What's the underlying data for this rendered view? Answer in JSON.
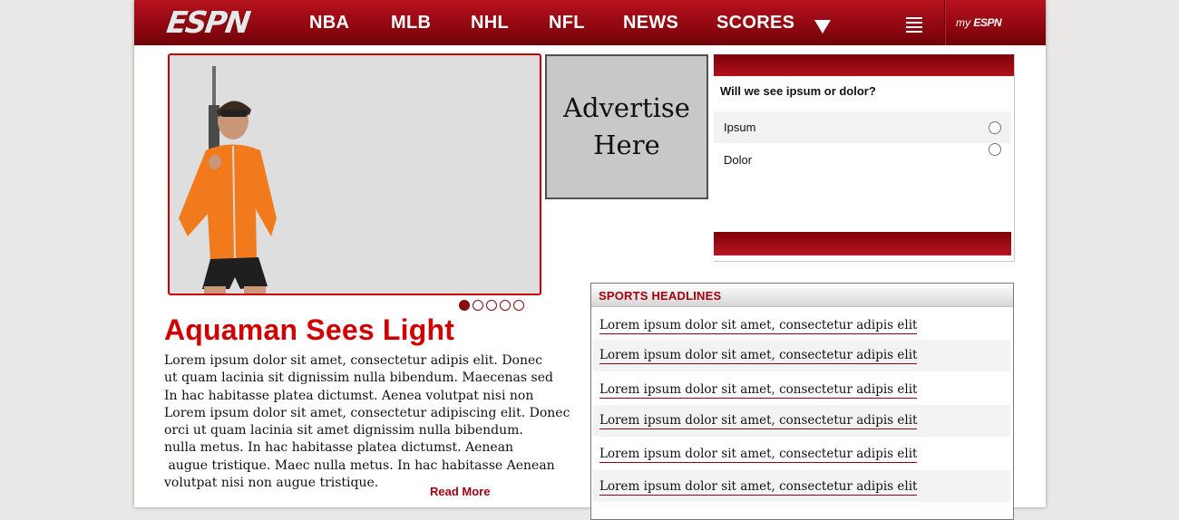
{
  "header": {
    "logo_text": "ESPN",
    "nav": [
      "NBA",
      "MLB",
      "NHL",
      "NFL",
      "NEWS",
      "SCORES"
    ],
    "my_label_prefix": "my",
    "my_label_brand": "ESPN"
  },
  "hero": {
    "slide_count": 5,
    "active_slide": 1,
    "headline": "Aquaman Sees Light",
    "body_lines": [
      "Lorem ipsum dolor sit amet, consectetur adipis elit. Donec",
      "ut quam lacinia sit dignissim nulla bibendum. Maecenas sed",
      "In hac habitasse platea dictumst. Aenea volutpat nisi non",
      "Lorem ipsum dolor sit amet, consectetur adipiscing elit. Donec",
      "orci ut quam lacinia sit amet dignissim nulla bibendum.",
      "nulla metus. In hac habitasse platea dictumst. Aenean",
      " augue tristique. Maec nulla metus. In hac habitasse Aenean",
      "volutpat nisi non augue tristique."
    ],
    "read_more": "Read More"
  },
  "ad": {
    "line1": "Advertise",
    "line2": "Here"
  },
  "poll": {
    "question": "Will we see ipsum or dolor?",
    "options": [
      "Ipsum",
      "Dolor"
    ]
  },
  "headlines": {
    "title": "SPORTS HEADLINES",
    "items": [
      "Lorem ipsum dolor sit amet, consectetur adipis elit",
      "Lorem ipsum dolor sit amet, consectetur adipis elit",
      "Lorem ipsum dolor sit amet, consectetur adipis elit",
      "Lorem ipsum dolor sit amet, consectetur adipis elit",
      "Lorem ipsum dolor sit amet, consectetur adipis elit",
      "Lorem ipsum dolor sit amet, consectetur adipis elit"
    ]
  },
  "colors": {
    "brand_red": "#a5000c",
    "headline_red": "#d10000",
    "page_bg": "#e9e8e6"
  }
}
